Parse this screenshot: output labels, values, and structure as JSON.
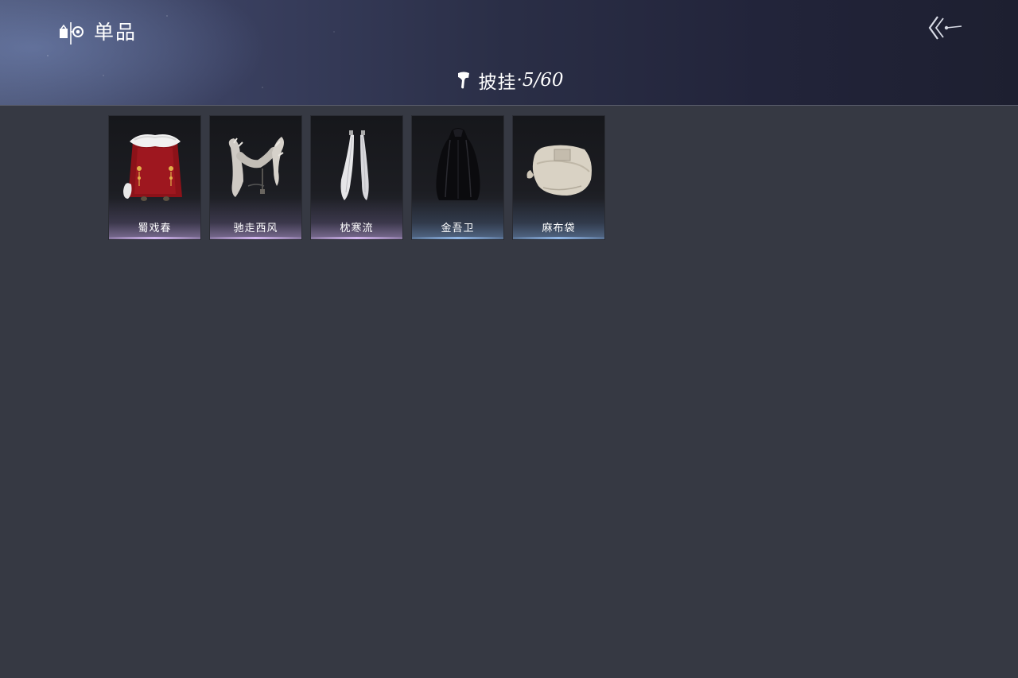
{
  "header": {
    "title": "单品",
    "logo_icon": "split-eye-logo-icon",
    "back_icon": "double-chevron-back-icon"
  },
  "category": {
    "icon": "cape-icon",
    "label": "披挂",
    "count": "·5/60"
  },
  "items": [
    {
      "name": "蜀戏春",
      "icon": "red-fur-cape-icon",
      "rarity_color": "#c4a3e6"
    },
    {
      "name": "驰走西风",
      "icon": "fur-stole-icon",
      "rarity_color": "#c4a3e6"
    },
    {
      "name": "枕寒流",
      "icon": "white-ribbons-icon",
      "rarity_color": "#c4a3e6"
    },
    {
      "name": "金吾卫",
      "icon": "black-cloak-icon",
      "rarity_color": "#8fb1da"
    },
    {
      "name": "麻布袋",
      "icon": "sack-icon",
      "rarity_color": "#8fb1da"
    }
  ],
  "colors": {
    "background": "#363943",
    "header_dark": "#1d1f30",
    "header_light": "#4a5373"
  }
}
